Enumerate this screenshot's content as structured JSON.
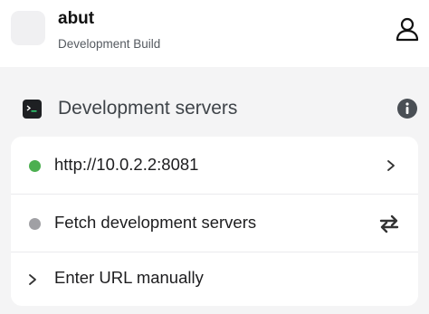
{
  "header": {
    "app_name": "abut",
    "subtitle": "Development Build",
    "icons": {
      "user": "user-icon"
    }
  },
  "section": {
    "title": "Development servers",
    "icons": {
      "leading": "terminal-icon",
      "trailing": "info-icon"
    }
  },
  "servers": {
    "items": [
      {
        "label": "http://10.0.2.2:8081",
        "status_color": "#4caf50",
        "trailing_icon": "chevron-right-icon"
      },
      {
        "label": "Fetch development servers",
        "status_color": "#a0a0a4",
        "trailing_icon": "refresh-icon"
      },
      {
        "label": "Enter URL manually",
        "leading_icon": "chevron-right-icon"
      }
    ]
  }
}
